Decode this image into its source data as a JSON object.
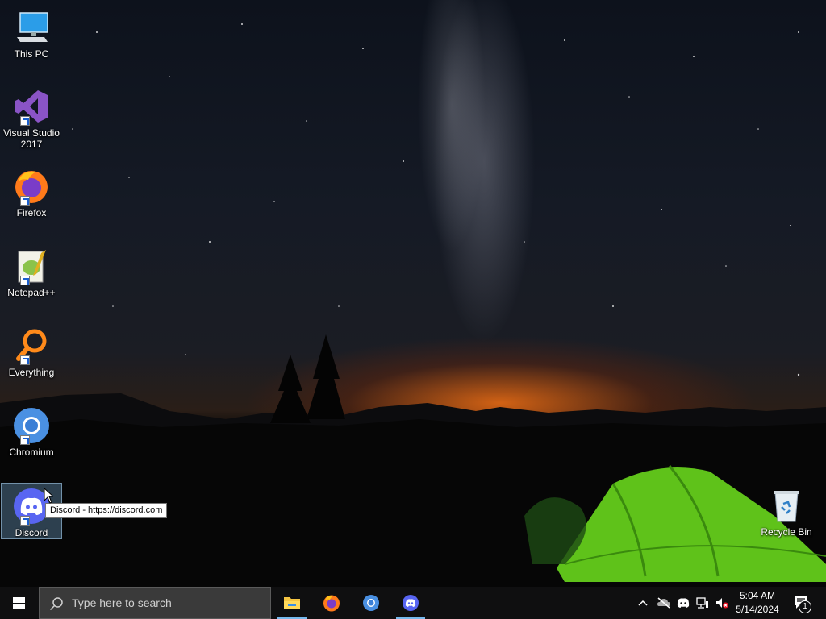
{
  "desktop": {
    "icons": [
      {
        "label": "This PC"
      },
      {
        "label": "Visual Studio 2017"
      },
      {
        "label": "Firefox"
      },
      {
        "label": "Notepad++"
      },
      {
        "label": "Everything"
      },
      {
        "label": "Chromium"
      },
      {
        "label": "Discord"
      },
      {
        "label": "Recycle Bin"
      }
    ],
    "tooltip": "Discord - https://discord.com"
  },
  "taskbar": {
    "search_placeholder": "Type here to search",
    "apps": [
      "file-explorer",
      "firefox",
      "chromium",
      "discord"
    ],
    "clock": {
      "time": "5:04 AM",
      "date": "5/14/2024"
    },
    "notification_count": "1"
  },
  "colors": {
    "accent": "#76b9ed",
    "taskbar": "#0f0f10",
    "discord": "#5865f2"
  }
}
